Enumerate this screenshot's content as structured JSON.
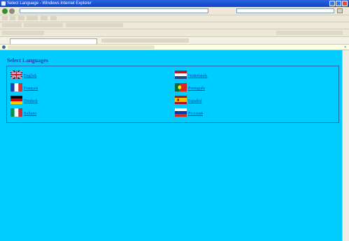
{
  "window": {
    "title": "Select Language - Windows Internet Explorer"
  },
  "content": {
    "heading": "Select Languages",
    "languages": [
      {
        "label": "English",
        "flag": "uk-flag"
      },
      {
        "label": "Français",
        "flag": "france-flag"
      },
      {
        "label": "Deutsch",
        "flag": "germany-flag"
      },
      {
        "label": "Italiano",
        "flag": "italy-flag"
      },
      {
        "label": "Nederlands",
        "flag": "netherlands-flag"
      },
      {
        "label": "Português",
        "flag": "portugal-flag"
      },
      {
        "label": "Español",
        "flag": "spain-flag"
      },
      {
        "label": "Русский",
        "flag": "russia-flag"
      }
    ]
  },
  "colors": {
    "page_background": "#00ccff",
    "heading": "#1f3fa8",
    "link": "#1b30c8",
    "border": "#1d6db0"
  }
}
